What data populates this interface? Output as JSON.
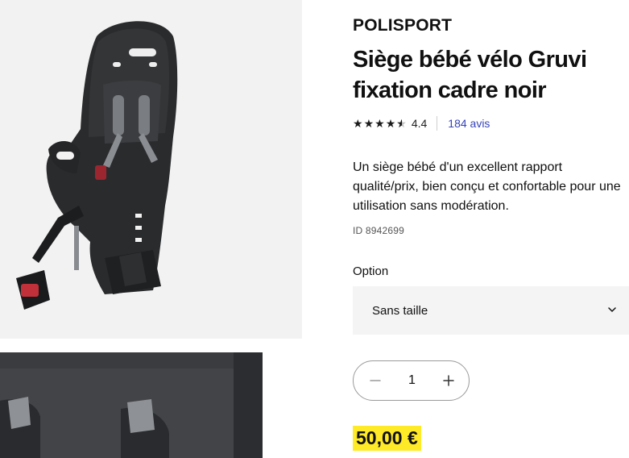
{
  "product": {
    "brand": "POLISPORT",
    "title": "Siège bébé vélo Gruvi fixation cadre noir",
    "rating": {
      "stars_filled": 4.5,
      "stars_max": 5,
      "value": "4.4",
      "reviews_label": "184 avis"
    },
    "description": "Un siège bébé d'un excellent rapport qualité/prix, bien conçu et confortable pour une utilisation sans modération.",
    "reference": "ID 8942699",
    "option": {
      "label": "Option",
      "selected": "Sans taille"
    },
    "quantity": {
      "value": "1"
    },
    "price": "50,00 €"
  },
  "icons": {
    "star": "star-icon",
    "chevron": "chevron-down-icon",
    "minus": "minus-icon",
    "plus": "plus-icon"
  },
  "colors": {
    "price_highlight": "#ffea28",
    "link": "#3643ba",
    "option_bg": "#f4f4f4",
    "gallery_bg": "#f2f2f2"
  }
}
